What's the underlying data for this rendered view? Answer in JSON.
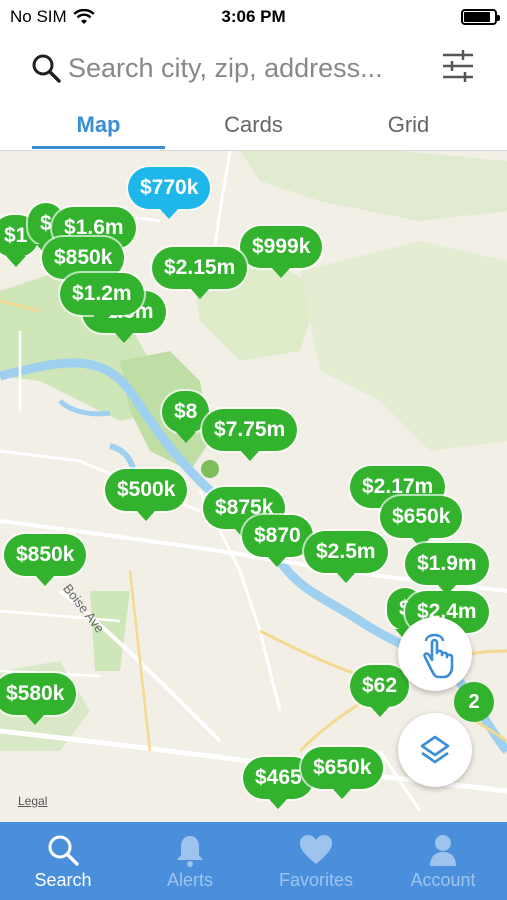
{
  "status": {
    "carrier": "No SIM",
    "time": "3:06 PM",
    "battery_level": 0.85
  },
  "search": {
    "placeholder": "Search city, zip, address..."
  },
  "tabs": [
    {
      "label": "Map",
      "active": true
    },
    {
      "label": "Cards",
      "active": false
    },
    {
      "label": "Grid",
      "active": false
    }
  ],
  "map": {
    "street_label": "Boise Ave",
    "legal": "Legal",
    "cluster_count": "2",
    "pins": [
      {
        "label": "$770k",
        "color": "#1fb7ea"
      },
      {
        "label": "$1",
        "color": "#33b22e"
      },
      {
        "label": "$",
        "color": "#33b22e"
      },
      {
        "label": "$1.6m",
        "color": "#33b22e"
      },
      {
        "label": "$850k",
        "color": "#33b22e"
      },
      {
        "label": "$999k",
        "color": "#33b22e"
      },
      {
        "label": "$2.15m",
        "color": "#33b22e"
      },
      {
        "label": "$1.2m",
        "color": "#33b22e"
      },
      {
        "label": "$1.6m",
        "color": "#33b22e"
      },
      {
        "label": "$8",
        "color": "#33b22e"
      },
      {
        "label": "$7.75m",
        "color": "#33b22e"
      },
      {
        "label": "$500k",
        "color": "#33b22e"
      },
      {
        "label": "$875k",
        "color": "#33b22e"
      },
      {
        "label": "$870",
        "color": "#33b22e"
      },
      {
        "label": "$2.5m",
        "color": "#33b22e"
      },
      {
        "label": "$2.17m",
        "color": "#33b22e"
      },
      {
        "label": "$650k",
        "color": "#33b22e"
      },
      {
        "label": "$1.9m",
        "color": "#33b22e"
      },
      {
        "label": "$",
        "color": "#33b22e"
      },
      {
        "label": "$2.4m",
        "color": "#33b22e"
      },
      {
        "label": "$850k",
        "color": "#33b22e"
      },
      {
        "label": "$580k",
        "color": "#33b22e"
      },
      {
        "label": "$62",
        "color": "#33b22e"
      },
      {
        "label": "$465",
        "color": "#33b22e"
      },
      {
        "label": "$650k",
        "color": "#33b22e"
      }
    ]
  },
  "bottom_nav": [
    {
      "label": "Search",
      "icon": "search-icon",
      "active": true
    },
    {
      "label": "Alerts",
      "icon": "bell-icon",
      "active": false
    },
    {
      "label": "Favorites",
      "icon": "heart-icon",
      "active": false
    },
    {
      "label": "Account",
      "icon": "person-icon",
      "active": false
    }
  ],
  "colors": {
    "accent": "#3a8ed6",
    "pin_green": "#33b22e",
    "pin_blue": "#1fb7ea",
    "nav_bg": "#4a8fdb"
  }
}
